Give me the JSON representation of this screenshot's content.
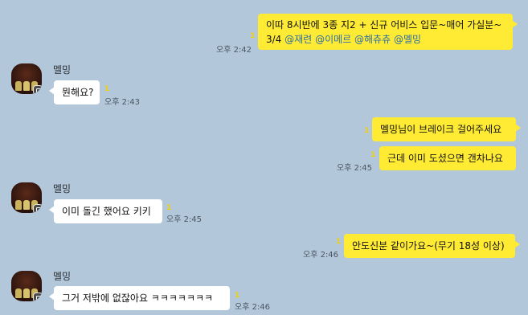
{
  "messages": [
    {
      "side": "mine",
      "line1": "이따 8시반에 3종 지2 + 신규 어비스 입문~매어 가실분~",
      "line2_prefix": "3/4",
      "mentions": [
        "@재련",
        "@이메르",
        "@해츄츄",
        "@멜밍"
      ],
      "time": "오후 2:42",
      "unread": "1"
    },
    {
      "side": "theirs",
      "sender": "멜밍",
      "text": "뭔해요?",
      "time": "오후 2:43",
      "unread": "1"
    },
    {
      "side": "mine",
      "text": "멜밍님이 브레이크 걸어주세요",
      "unread": "1"
    },
    {
      "side": "mine",
      "text": "근데 이미 도셨으면 갠차나요",
      "time": "오후 2:45",
      "unread": "1"
    },
    {
      "side": "theirs",
      "sender": "멜밍",
      "text": "이미 돌긴 했어요 키키",
      "time": "오후 2:45",
      "unread": "1"
    },
    {
      "side": "mine",
      "text": "안도신분 같이가요~(무기 18성 이상)",
      "time": "오후 2:46",
      "unread": "1"
    },
    {
      "side": "theirs",
      "sender": "멜밍",
      "text": "그거 저밖에 없잖아요 ㅋㅋㅋㅋㅋㅋㅋ",
      "time": "오후 2:46",
      "unread": "1"
    }
  ],
  "colors": {
    "background": "#b2c7d9",
    "my_bubble": "#ffeb33",
    "their_bubble": "#ffffff",
    "unread_count": "#f3d100",
    "mention": "#2b6ea8"
  },
  "icons": {
    "avatar_badge": "profile-badge-icon"
  }
}
